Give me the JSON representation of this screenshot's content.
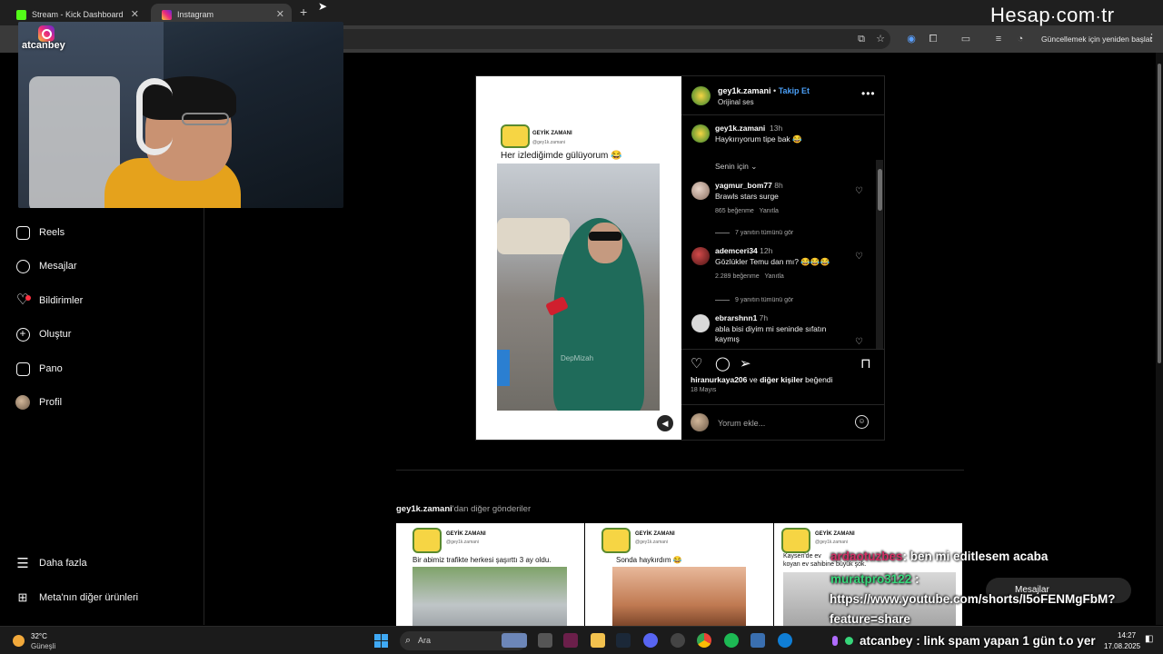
{
  "browser": {
    "tabs": [
      {
        "title": "Stream - Kick Dashboard",
        "favicon_color": "#53fc18"
      },
      {
        "title": "Instagram",
        "favicon_color": "#e1306c"
      }
    ],
    "new_tab": "+",
    "update_button": "Güncellemek için yeniden başlat"
  },
  "watermark": {
    "left": "Hesap",
    "right": "com",
    "tld": "tr"
  },
  "webcam": {
    "username": "atcanbey"
  },
  "sidebar": {
    "items": [
      {
        "label": "Reels",
        "icon": "reels-icon"
      },
      {
        "label": "Mesajlar",
        "icon": "messenger-icon"
      },
      {
        "label": "Bildirimler",
        "icon": "heart-icon"
      },
      {
        "label": "Oluştur",
        "icon": "plus-square-icon"
      },
      {
        "label": "Pano",
        "icon": "dashboard-icon"
      },
      {
        "label": "Profil",
        "icon": "avatar"
      }
    ],
    "more": "Daha fazla",
    "meta": "Meta'nın diğer ürünleri"
  },
  "post": {
    "username": "gey1k.zamani",
    "separator": "•",
    "follow": "Takip Et",
    "audio": "Orijinal ses",
    "media": {
      "brand": "GEYİK ZAMANI",
      "handle": "@gey1k.zamani",
      "caption": "Her izlediğimde gülüyorum 😂",
      "watermark": "DepMizah"
    },
    "caption_comment": {
      "user": "gey1k.zamani",
      "time": "13h",
      "text": "Haykırıyorum tipe bak 😂"
    },
    "for_you": "Senin için ⌄",
    "comments": [
      {
        "user": "yagmur_bom77",
        "time": "8h",
        "text": "Brawls stars surge",
        "likes": "865 beğenme",
        "reply": "Yanıtla",
        "replies": "7 yanıtın tümünü gör"
      },
      {
        "user": "ademceri34",
        "time": "12h",
        "text": "Gözlükler Temu dan mı? 😂😂😂",
        "likes": "2.289 beğenme",
        "reply": "Yanıtla",
        "replies": "9 yanıtın tümünü gör"
      },
      {
        "user": "ebrarshnn1",
        "time": "7h",
        "text": "abla bisi diyim mi seninde sıfatın kaymış"
      }
    ],
    "liked_by_user": "hiranurkaya206",
    "liked_by_mid": " ve ",
    "liked_by_others": "diğer kişiler",
    "liked_by_end": " beğendi",
    "date": "18 Mayıs",
    "comment_placeholder": "Yorum ekle..."
  },
  "more_posts": {
    "user": "gey1k.zamani",
    "suffix": "'dan diğer gönderiler",
    "items": [
      {
        "brand": "GEYİK ZAMANI",
        "handle": "@gey1k.zamani",
        "caption": "Bir abimiz trafikte herkesi şaşırttı 3 ay oldu."
      },
      {
        "brand": "GEYİK ZAMANI",
        "handle": "@gey1k.zamani",
        "caption": "Sonda haykırdım 😂"
      },
      {
        "brand": "GEYİK ZAMANI",
        "handle": "@gey1k.zamani",
        "caption": "Kayseri'de ev"
      }
    ]
  },
  "chat": {
    "line1_user": "ardaotuzbes",
    "line1_msg": ": ben mi editlesem acaba",
    "line1_prefix": "Kayseri'de ev",
    "line1_sub": "koyan ev sahibine büyük şok.",
    "line2_user": "muratpro3122",
    "line2_sep": ":",
    "line3": "https://www.youtube.com/shorts/I5oFENMgFbM?",
    "line4": "feature=share",
    "line5": "atcanbey : link spam yapan 1 gün t.o yer",
    "messages_pill": "Mesajlar"
  },
  "taskbar": {
    "temp": "32°C",
    "weather": "Güneşli",
    "search": "Ara",
    "time": "14:27",
    "date": "17.08.2025"
  }
}
